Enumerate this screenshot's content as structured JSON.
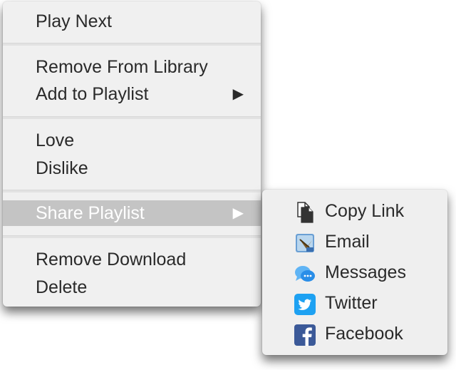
{
  "main_menu": {
    "items": [
      {
        "label": "Play Next"
      },
      {
        "label": "Remove From Library"
      },
      {
        "label": "Add to Playlist",
        "submenu_arrow": "▶"
      },
      {
        "label": "Love"
      },
      {
        "label": "Dislike"
      },
      {
        "label": "Share Playlist",
        "submenu_arrow": "▶",
        "highlighted": true
      },
      {
        "label": "Remove Download"
      },
      {
        "label": "Delete"
      }
    ]
  },
  "share_submenu": {
    "items": [
      {
        "label": "Copy Link",
        "icon": "copy-link-icon"
      },
      {
        "label": "Email",
        "icon": "mail-app-icon"
      },
      {
        "label": "Messages",
        "icon": "messages-icon"
      },
      {
        "label": "Twitter",
        "icon": "twitter-icon"
      },
      {
        "label": "Facebook",
        "icon": "facebook-icon"
      }
    ]
  },
  "colors": {
    "menu_background": "#f0f0f0",
    "highlight": "#c4c4c4",
    "text": "#2a2a2a",
    "twitter_blue": "#1da1f2",
    "facebook_blue": "#3b5998"
  }
}
